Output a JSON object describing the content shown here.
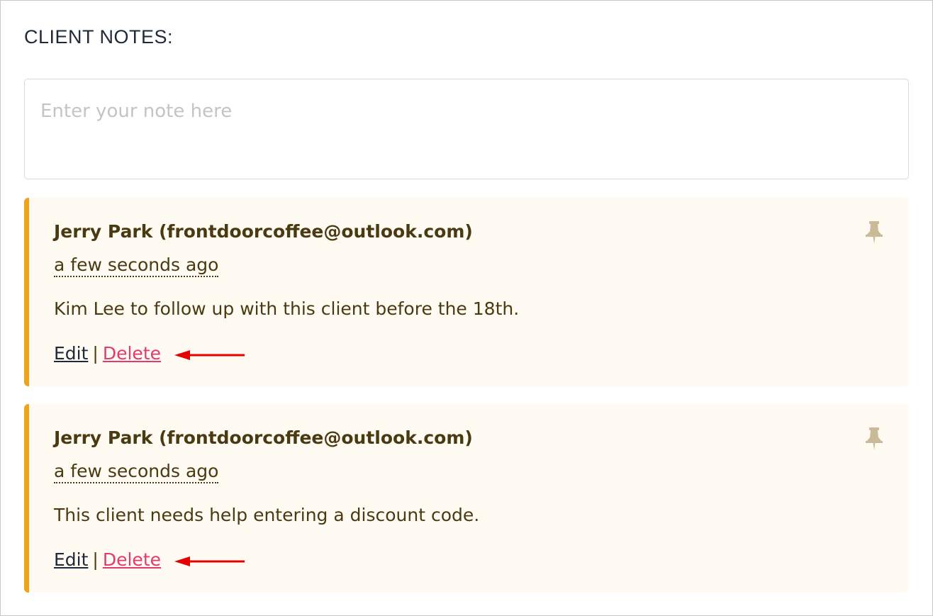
{
  "section": {
    "title": "CLIENT NOTES:"
  },
  "note_input": {
    "placeholder": "Enter your note here",
    "value": ""
  },
  "colors": {
    "accent_border": "#eea31a",
    "card_background": "#fffbf2",
    "delete_link": "#e23a6c",
    "annotation_arrow": "#e60000"
  },
  "notes": [
    {
      "author": "Jerry Park (frontdoorcoffee@outlook.com)",
      "timestamp": "a few seconds ago",
      "body": "Kim Lee to follow up with this client before the 18th.",
      "edit_label": "Edit",
      "separator": "|",
      "delete_label": "Delete",
      "pin_icon": "pin-icon"
    },
    {
      "author": "Jerry Park (frontdoorcoffee@outlook.com)",
      "timestamp": "a few seconds ago",
      "body": "This client needs help entering a discount code.",
      "edit_label": "Edit",
      "separator": "|",
      "delete_label": "Delete",
      "pin_icon": "pin-icon"
    }
  ]
}
